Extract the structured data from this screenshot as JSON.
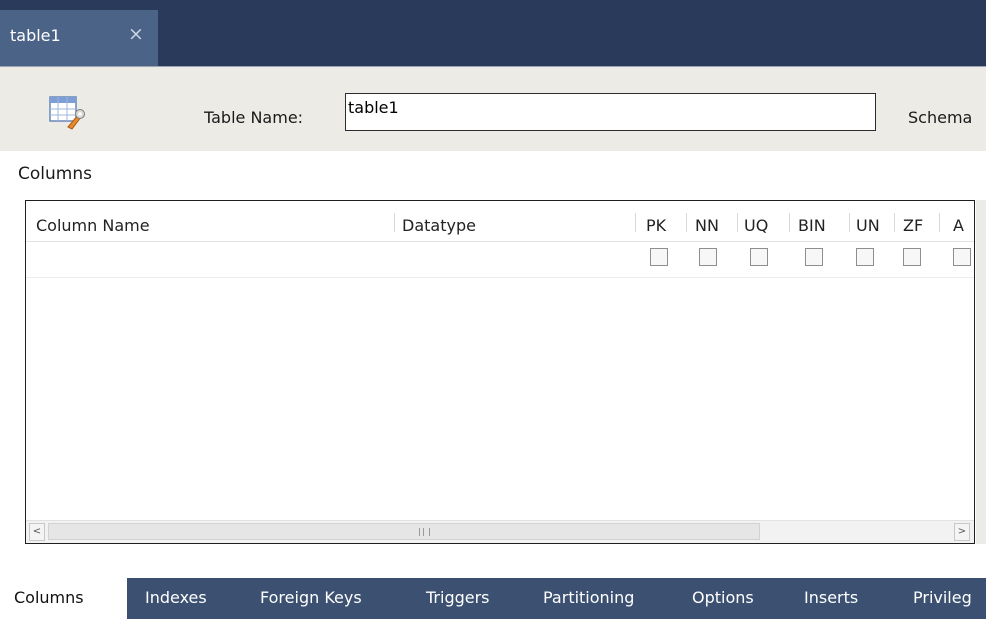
{
  "document_tab": {
    "label": "table1",
    "close_glyph": "×"
  },
  "header": {
    "icon": "table-wrench-icon",
    "table_name_label": "Table Name:",
    "table_name_value": "table1",
    "schema_label": "Schema"
  },
  "section_title": "Columns",
  "grid": {
    "headers": [
      "Column Name",
      "Datatype",
      "PK",
      "NN",
      "UQ",
      "BIN",
      "UN",
      "ZF",
      "A"
    ],
    "checkbox_columns": [
      "PK",
      "NN",
      "UQ",
      "BIN",
      "UN",
      "ZF",
      "A"
    ],
    "scroll_left_glyph": "<",
    "scroll_right_glyph": ">"
  },
  "bottom_tabs": [
    "Columns",
    "Indexes",
    "Foreign Keys",
    "Triggers",
    "Partitioning",
    "Options",
    "Inserts",
    "Privileg"
  ],
  "colors": {
    "tabstrip": "#2a3a5a",
    "active_doc_tab": "#4b6387",
    "header_bg": "#ecebe6",
    "bottom_tabs": "#3c5172"
  }
}
